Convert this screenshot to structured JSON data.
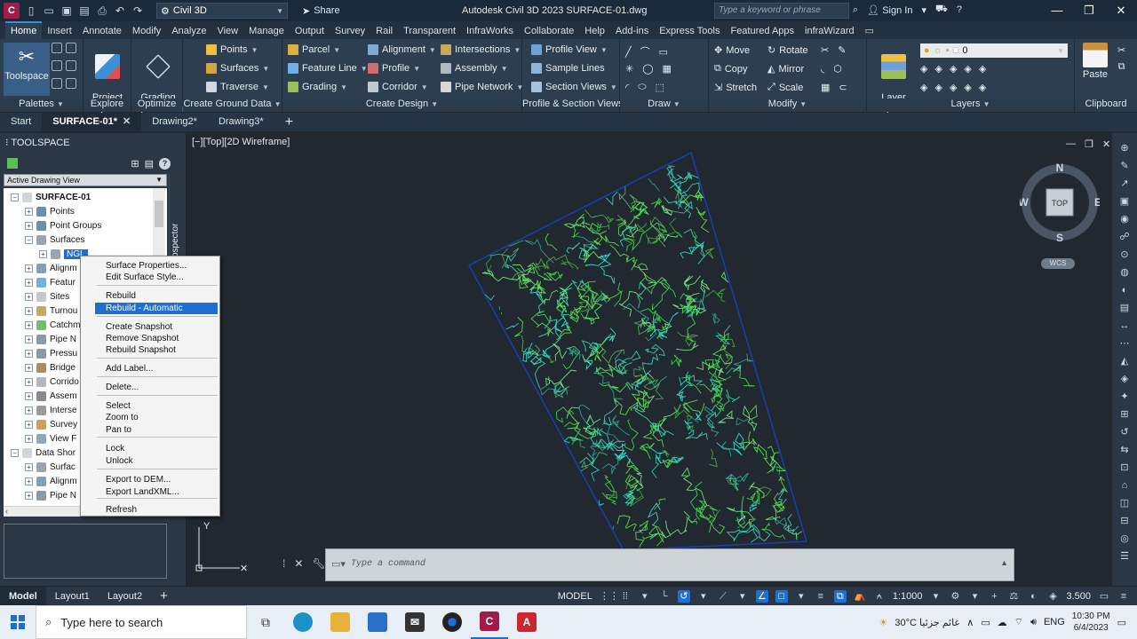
{
  "titlebar": {
    "app_badge": "C",
    "workspace": "Civil 3D",
    "share": "Share",
    "title": "Autodesk Civil 3D 2023    SURFACE-01.dwg",
    "search_placeholder": "Type a keyword or phrase",
    "sign_in": "Sign In"
  },
  "ribbon_tabs": [
    "Home",
    "Insert",
    "Annotate",
    "Modify",
    "Analyze",
    "View",
    "Manage",
    "Output",
    "Survey",
    "Rail",
    "Transparent",
    "InfraWorks",
    "Collaborate",
    "Help",
    "Add-ins",
    "Express Tools",
    "Featured Apps",
    "infraWizard"
  ],
  "ribbon": {
    "palettes": {
      "toolspace": "Toolspace",
      "label": "Palettes"
    },
    "explore": {
      "project_explorer": "Project\nExplorer",
      "label": "Explore"
    },
    "optimize": {
      "grading_optimization": "Grading\nOptimization",
      "label": "Optimize"
    },
    "ground": {
      "points": "Points",
      "surfaces": "Surfaces",
      "traverse": "Traverse",
      "label": "Create Ground Data"
    },
    "design": {
      "parcel": "Parcel",
      "feature_line": "Feature Line",
      "grading": "Grading",
      "alignment": "Alignment",
      "profile": "Profile",
      "corridor": "Corridor",
      "intersections": "Intersections",
      "assembly": "Assembly",
      "pipe_network": "Pipe Network",
      "label": "Create Design"
    },
    "profile_section": {
      "profile_view": "Profile View",
      "sample_lines": "Sample Lines",
      "section_views": "Section Views",
      "label": "Profile & Section Views"
    },
    "draw": {
      "label": "Draw"
    },
    "modify": {
      "move": "Move",
      "rotate": "Rotate",
      "copy": "Copy",
      "mirror": "Mirror",
      "stretch": "Stretch",
      "scale": "Scale",
      "label": "Modify"
    },
    "layers": {
      "layer_properties": "Layer\nProperties",
      "current_layer": "0",
      "label": "Layers"
    },
    "clipboard": {
      "paste": "Paste",
      "label": "Clipboard"
    }
  },
  "doc_tabs": [
    "Start",
    "SURFACE-01*",
    "Drawing2*",
    "Drawing3*"
  ],
  "toolspace": {
    "title": "TOOLSPACE",
    "view_select": "Active Drawing View",
    "tree": [
      {
        "label": "SURFACE-01",
        "bold": true
      },
      {
        "label": "Points"
      },
      {
        "label": "Point Groups"
      },
      {
        "label": "Surfaces"
      },
      {
        "label": "NGL",
        "selected": true
      },
      {
        "label": "Alignm"
      },
      {
        "label": "Featur"
      },
      {
        "label": "Sites"
      },
      {
        "label": "Turnou"
      },
      {
        "label": "Catchm"
      },
      {
        "label": "Pipe N"
      },
      {
        "label": "Pressu"
      },
      {
        "label": "Bridge"
      },
      {
        "label": "Corrido"
      },
      {
        "label": "Assem"
      },
      {
        "label": "Interse"
      },
      {
        "label": "Survey"
      },
      {
        "label": "View F"
      },
      {
        "label": "Data Shor"
      },
      {
        "label": "Surfac"
      },
      {
        "label": "Alignm"
      },
      {
        "label": "Pipe N"
      }
    ],
    "prospector": "Prospector"
  },
  "context_menu": [
    "Surface Properties...",
    "Edit Surface Style...",
    "Rebuild",
    "Rebuild - Automatic",
    "Create Snapshot",
    "Remove Snapshot",
    "Rebuild Snapshot",
    "Add Label...",
    "Delete...",
    "Select",
    "Zoom to",
    "Pan to",
    "Lock",
    "Unlock",
    "Export to DEM...",
    "Export LandXML...",
    "Refresh"
  ],
  "viewport": {
    "label": "[−][Top][2D Wireframe]",
    "viewcube": {
      "n": "N",
      "s": "S",
      "e": "E",
      "w": "W",
      "top": "TOP"
    },
    "wcs": "WCS",
    "ucs_y": "Y"
  },
  "command_line": {
    "placeholder": "Type a command"
  },
  "status": {
    "layouts": [
      "Model",
      "Layout1",
      "Layout2"
    ],
    "model": "MODEL",
    "scale": "1:1000",
    "elevation": "3.500"
  },
  "taskbar": {
    "search": "Type here to search",
    "weather": "30°C  غائم جزئيا",
    "lang": "ENG",
    "time": "10:30 PM",
    "date": "6/4/2023",
    "badge_c3d": "C",
    "badge_acad": "A"
  },
  "colors": {
    "accent": "#1f6fd1",
    "ribbon": "#2c3e50",
    "viewport": "#212830",
    "contour_green": "#3fd14a",
    "contour_cyan": "#2fd6c4",
    "boundary": "#1a3fb0"
  }
}
